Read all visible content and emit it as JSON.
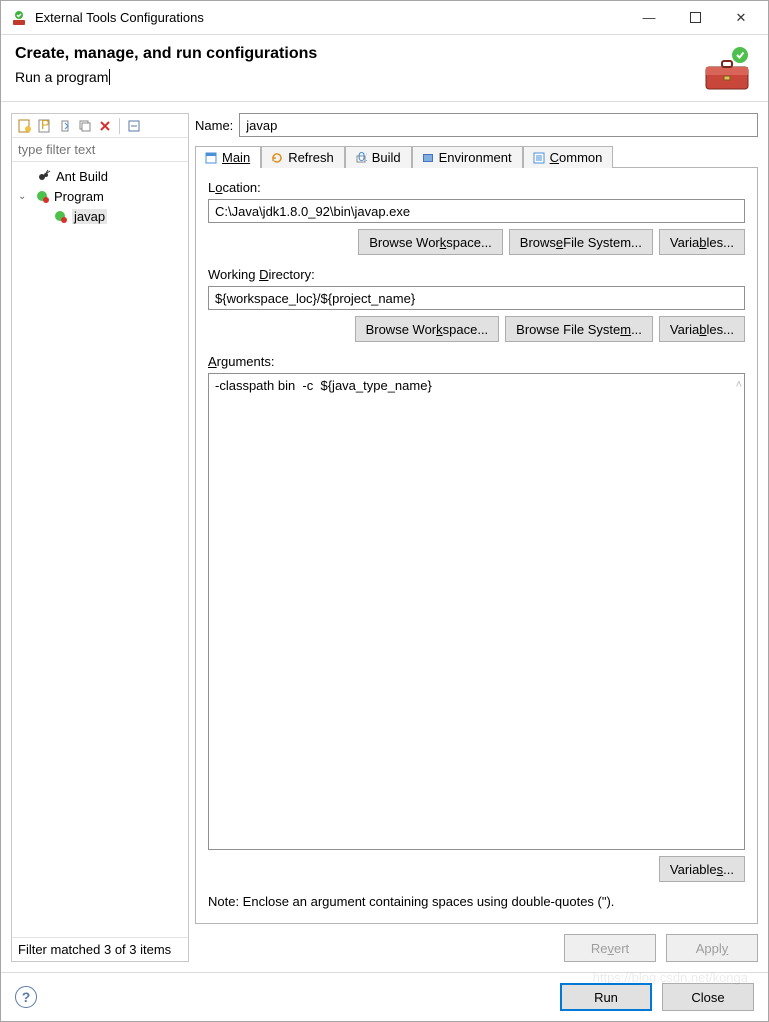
{
  "windowTitle": "External Tools Configurations",
  "header": {
    "title": "Create, manage, and run configurations",
    "subtitle": "Run a program"
  },
  "titlebar": {
    "minimize": "—",
    "maximize": "□",
    "close": "✕"
  },
  "leftPane": {
    "filterPlaceholder": "type filter text",
    "tree": {
      "antBuild": "Ant Build",
      "program": "Program",
      "javap": "javap"
    },
    "filterStatus": "Filter matched 3 of 3 items"
  },
  "form": {
    "nameLabel": "Name:",
    "nameValue": "javap",
    "tabs": {
      "main": "Main",
      "refresh": "Refresh",
      "build": "Build",
      "environment": "Environment",
      "common": "Common"
    },
    "location": {
      "label_pre": "L",
      "label_u": "o",
      "label_post": "cation:",
      "value": "C:\\Java\\jdk1.8.0_92\\bin\\javap.exe"
    },
    "workingDir": {
      "label_pre": "Working ",
      "label_u": "D",
      "label_post": "irectory:",
      "value": "${workspace_loc}/${project_name}"
    },
    "arguments": {
      "label_pre": "",
      "label_u": "A",
      "label_post": "rguments:",
      "value": "-classpath bin  -c  ${java_type_name}"
    },
    "buttons": {
      "browseWorkspace_pre": "Browse Wor",
      "browseWorkspace_u": "k",
      "browseWorkspace_post": "space...",
      "browseFileSystem_pre": "Brows",
      "browseFileSystem_u": "e",
      "browseFileSystem_post": " File System...",
      "variables_pre": "Varia",
      "variables_u": "b",
      "variables_post": "les...",
      "browseWorkspace2_pre": "Browse Wor",
      "browseWorkspace2_u": "k",
      "browseWorkspace2_post": "space...",
      "browseFileSystem2_pre": "Browse File Syste",
      "browseFileSystem2_u": "m",
      "browseFileSystem2_post": "...",
      "variables2_pre": "Varia",
      "variables2_u": "b",
      "variables2_post": "les...",
      "variables3_pre": "Variable",
      "variables3_u": "s",
      "variables3_post": "..."
    },
    "note": "Note: Enclose an argument containing spaces using double-quotes (\")."
  },
  "actions": {
    "revert": "Revert",
    "apply": "Apply",
    "run_pre": "",
    "run_u": "R",
    "run_post": "un",
    "close": "Close"
  },
  "watermark": "https://blog.csdn.net/konga"
}
